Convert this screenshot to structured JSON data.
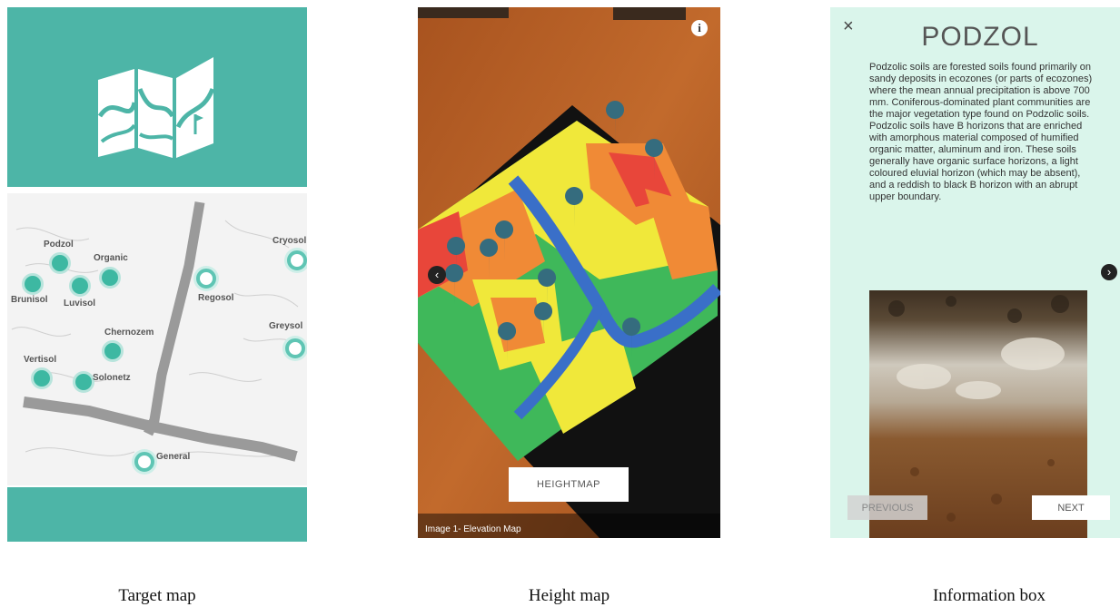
{
  "target_map": {
    "caption": "Target map",
    "soil_labels": [
      "Podzol",
      "Organic",
      "Cryosol",
      "Brunisol",
      "Luvisol",
      "Regosol",
      "Chernozem",
      "Greysol",
      "Vertisol",
      "Solonetz",
      "General"
    ]
  },
  "height_map": {
    "caption": "Height map",
    "button_label": "HEIGHTMAP",
    "image_caption": "Image 1- Elevation Map",
    "info_icon": "i"
  },
  "info_box": {
    "caption": "Information box",
    "close_icon": "×",
    "title": "PODZOL",
    "body": "Podzolic soils are forested soils found primarily on sandy deposits in ecozones (or parts of ecozones) where the mean annual precipitation is above 700 mm. Coniferous-dominated plant communities are the major vegetation type found on Podzolic soils. Podzolic soils have B horizons that are enriched with amorphous material composed of humified organic matter, aluminum and iron. These soils generally have organic surface horizons, a light coloured eluvial horizon (which may be absent), and a reddish to black B horizon with an abrupt upper boundary.",
    "prev_label": "PREVIOUS",
    "next_label": "NEXT"
  },
  "colors": {
    "teal": "#4db5a7",
    "mint_background": "#daf5eb",
    "elevation_high": "#e8463a",
    "elevation_mid": "#f0e83a",
    "elevation_low": "#3fb85a",
    "river": "#3a6fc8"
  }
}
